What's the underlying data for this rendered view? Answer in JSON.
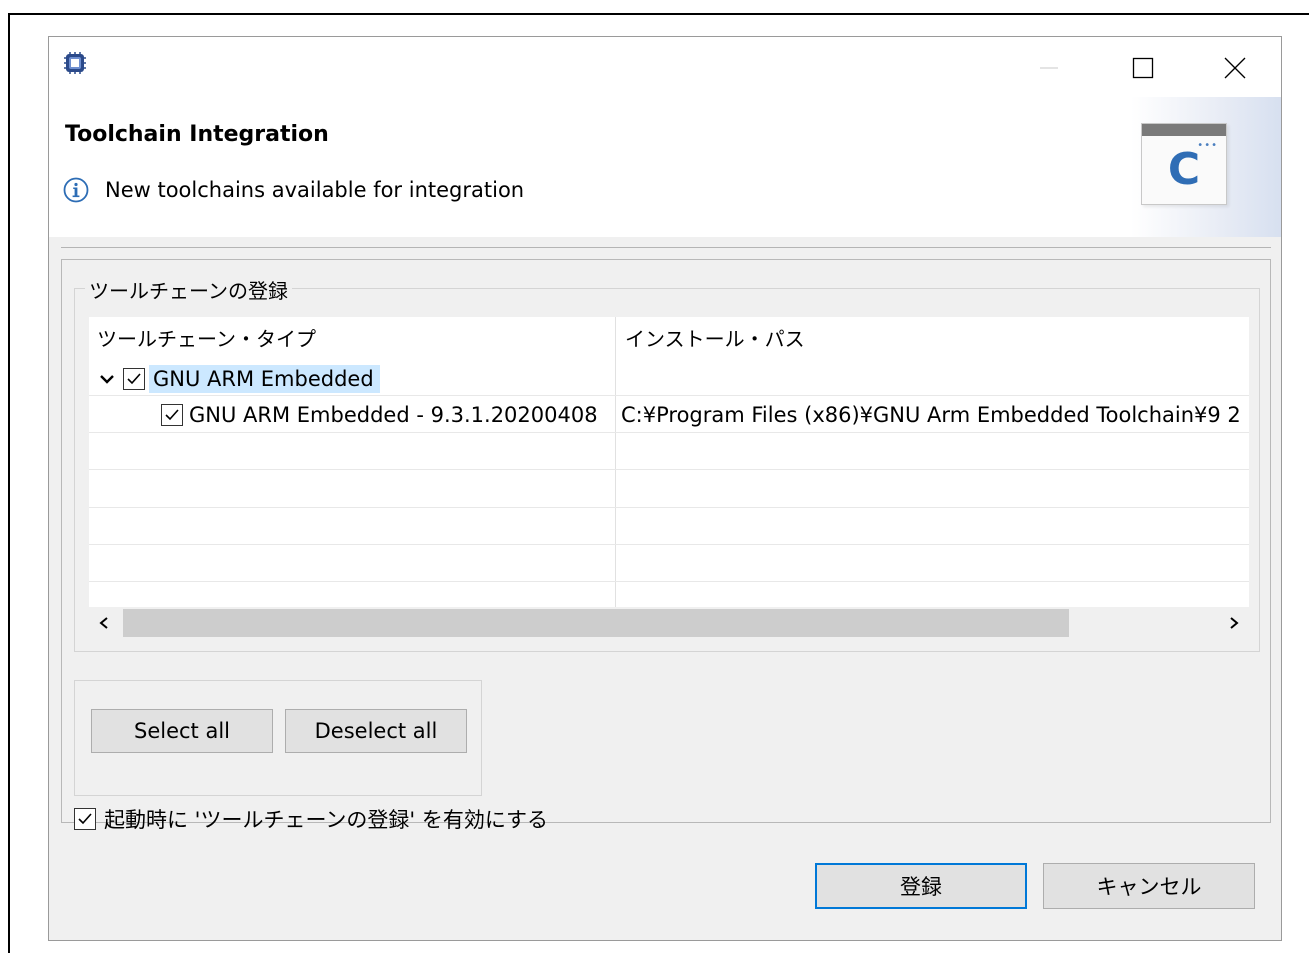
{
  "window": {
    "controls": {
      "minimize": "—",
      "maximize": "☐",
      "close": "✕"
    }
  },
  "banner": {
    "title": "Toolchain Integration",
    "message": "New toolchains available for integration",
    "info_icon": "info-icon",
    "image_letter": "C"
  },
  "group": {
    "legend": "ツールチェーンの登録"
  },
  "table": {
    "columns": [
      "ツールチェーン・タイプ",
      "インストール・パス"
    ],
    "rows": [
      {
        "label": "GNU ARM Embedded",
        "checked": true,
        "expanded": true,
        "selected": true,
        "path": ""
      },
      {
        "label": "GNU ARM Embedded - 9.3.1.20200408",
        "checked": true,
        "path": "C:¥Program Files (x86)¥GNU Arm Embedded Toolchain¥9 2"
      }
    ]
  },
  "scrollbar": {
    "left_arrow": "‹",
    "right_arrow": "›"
  },
  "buttons": {
    "select_all": "Select all",
    "deselect_all": "Deselect all",
    "register": "登録",
    "cancel": "キャンセル"
  },
  "enable_on_startup": {
    "label": "起動時に 'ツールチェーンの登録' を有効にする",
    "checked": true
  },
  "colors": {
    "selection": "#cce8ff",
    "accent": "#0078d7",
    "dialog_bg": "#f0f0f0"
  }
}
